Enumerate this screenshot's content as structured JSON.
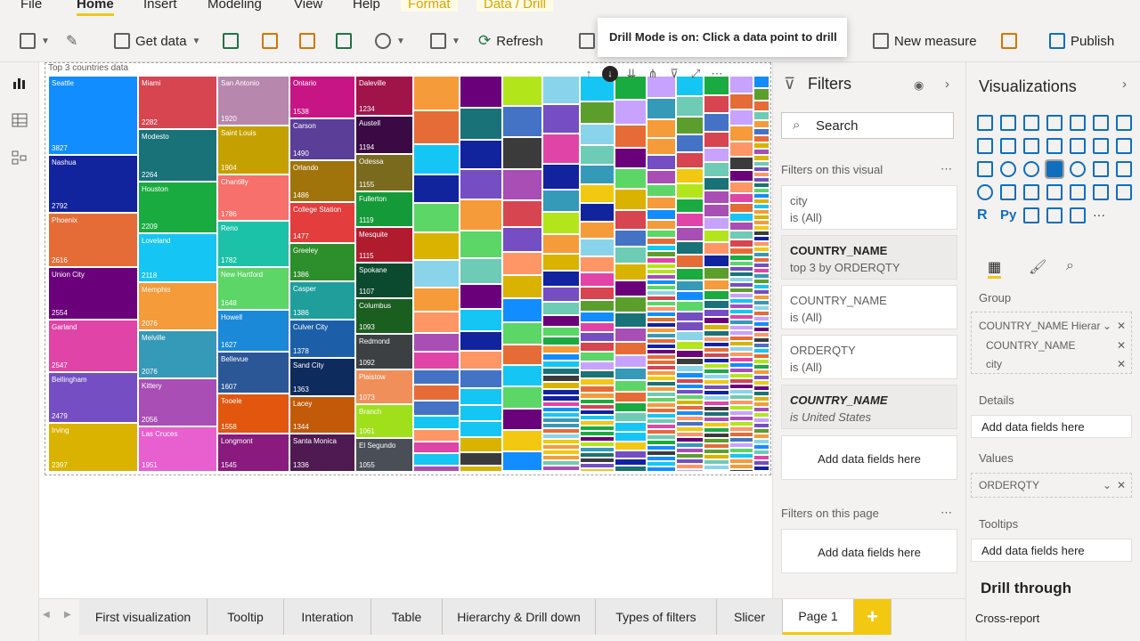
{
  "ribbon_tabs": [
    "File",
    "Home",
    "Insert",
    "Modeling",
    "View",
    "Help",
    "Format",
    "Data / Drill"
  ],
  "ribbon": {
    "get_data": "Get data",
    "refresh": "Refresh",
    "new_measure": "New measure",
    "publish": "Publish"
  },
  "tooltip": "Drill Mode is on: Click a data point to drill",
  "visual": {
    "title": "Top 3 countries data",
    "header_icons": [
      "drill-up-icon",
      "drill-mode-icon",
      "drill-down-next-icon",
      "expand-next-icon",
      "filter-icon",
      "focus-mode-icon",
      "more-options-icon"
    ]
  },
  "chart_data": {
    "type": "treemap",
    "measure": "ORDERQTY",
    "cells": [
      {
        "label": "Seattle",
        "value": "3827",
        "color": "#118dff"
      },
      {
        "label": "Nashua",
        "value": "2792",
        "color": "#12239e"
      },
      {
        "label": "Phoenix",
        "value": "2616",
        "color": "#e66c37"
      },
      {
        "label": "Union City",
        "value": "2554",
        "color": "#6b007b"
      },
      {
        "label": "Garland",
        "value": "2547",
        "color": "#e044a7"
      },
      {
        "label": "Bellingham",
        "value": "2479",
        "color": "#744ec2"
      },
      {
        "label": "Irving",
        "value": "2397",
        "color": "#d9b300"
      },
      {
        "label": "Miami",
        "value": "2282",
        "color": "#d64550"
      },
      {
        "label": "Modesto",
        "value": "2264",
        "color": "#197278"
      },
      {
        "label": "Houston",
        "value": "2209",
        "color": "#1aab40"
      },
      {
        "label": "Loveland",
        "value": "2118",
        "color": "#15c6f4"
      },
      {
        "label": "Memphis",
        "value": "2076",
        "color": "#f59b39"
      },
      {
        "label": "Melville",
        "value": "2076",
        "color": "#3599b8"
      },
      {
        "label": "Kittery",
        "value": "2056",
        "color": "#a84eb5"
      },
      {
        "label": "Las Cruces",
        "value": "1951",
        "color": "#e85fd0"
      },
      {
        "label": "San Antonio",
        "value": "1920",
        "color": "#b887ad"
      },
      {
        "label": "Saint Louis",
        "value": "1904",
        "color": "#c4a100"
      },
      {
        "label": "Chantilly",
        "value": "1786",
        "color": "#f7706b"
      },
      {
        "label": "Reno",
        "value": "1782",
        "color": "#1bc2a8"
      },
      {
        "label": "New Hartford",
        "value": "1648",
        "color": "#5bd667"
      },
      {
        "label": "Howell",
        "value": "1627",
        "color": "#1b88d8"
      },
      {
        "label": "Bellevue",
        "value": "1607",
        "color": "#2b5797"
      },
      {
        "label": "Tooele",
        "value": "1558",
        "color": "#e3560e"
      },
      {
        "label": "Longmont",
        "value": "1545",
        "color": "#8a1a7e"
      },
      {
        "label": "Ontario",
        "value": "1538",
        "color": "#c71585"
      },
      {
        "label": "Carson",
        "value": "1490",
        "color": "#5a3e98"
      },
      {
        "label": "Orlando",
        "value": "1486",
        "color": "#a0740b"
      },
      {
        "label": "College Station",
        "value": "1477",
        "color": "#e33d3d"
      },
      {
        "label": "Greeley",
        "value": "1386",
        "color": "#2c8f2c"
      },
      {
        "label": "Casper",
        "value": "1386",
        "color": "#1f9e9b"
      },
      {
        "label": "Culver City",
        "value": "1378",
        "color": "#1c5fa8"
      },
      {
        "label": "Sand City",
        "value": "1363",
        "color": "#0d2b5c"
      },
      {
        "label": "Lacey",
        "value": "1344",
        "color": "#c25a0a"
      },
      {
        "label": "Santa Monica",
        "value": "1336",
        "color": "#4f1a52"
      },
      {
        "label": "Daleville",
        "value": "1234",
        "color": "#a0144a"
      },
      {
        "label": "Austell",
        "value": "1194",
        "color": "#3b0a45"
      },
      {
        "label": "Odessa",
        "value": "1155",
        "color": "#7a6a1e"
      },
      {
        "label": "Fullerton",
        "value": "1119",
        "color": "#159a3a"
      },
      {
        "label": "Mesquite",
        "value": "1115",
        "color": "#b01c2e"
      },
      {
        "label": "Spokane",
        "value": "1107",
        "color": "#0b4a2e"
      },
      {
        "label": "Columbus",
        "value": "1093",
        "color": "#1a5e20"
      },
      {
        "label": "Redmond",
        "value": "1092",
        "color": "#3d4043"
      },
      {
        "label": "Plaistow",
        "value": "1073",
        "color": "#f08f59"
      },
      {
        "label": "Branch",
        "value": "1061",
        "color": "#9fe01a"
      },
      {
        "label": "El Segundo",
        "value": "1055",
        "color": "#4a4e57"
      }
    ]
  },
  "filters": {
    "title": "Filters",
    "search_placeholder": "Search",
    "on_visual_label": "Filters on this visual",
    "cards": [
      {
        "name": "city",
        "value": "is (All)"
      },
      {
        "name": "COUNTRY_NAME",
        "value": "top 3 by ORDERQTY"
      },
      {
        "name": "COUNTRY_NAME",
        "value": "is (All)"
      },
      {
        "name": "ORDERQTY",
        "value": "is (All)"
      },
      {
        "name": "COUNTRY_NAME",
        "value": "is United States"
      }
    ],
    "add_fields": "Add data fields here",
    "on_page_label": "Filters on this page",
    "add_fields_page": "Add data fields here"
  },
  "visualizations": {
    "title": "Visualizations",
    "group_label": "Group",
    "group_fields": [
      "COUNTRY_NAME Hierar",
      "COUNTRY_NAME",
      "city"
    ],
    "details_label": "Details",
    "details_add": "Add data fields here",
    "values_label": "Values",
    "values_field": "ORDERQTY",
    "tooltips_label": "Tooltips",
    "tooltips_add": "Add data fields here",
    "drill_through": "Drill through",
    "cross_report": "Cross-report"
  },
  "page_tabs": [
    "First visualization",
    "Tooltip",
    "Interation",
    "Table",
    "Hierarchy & Drill down",
    "Types of filters",
    "Slicer",
    "Page 1"
  ]
}
